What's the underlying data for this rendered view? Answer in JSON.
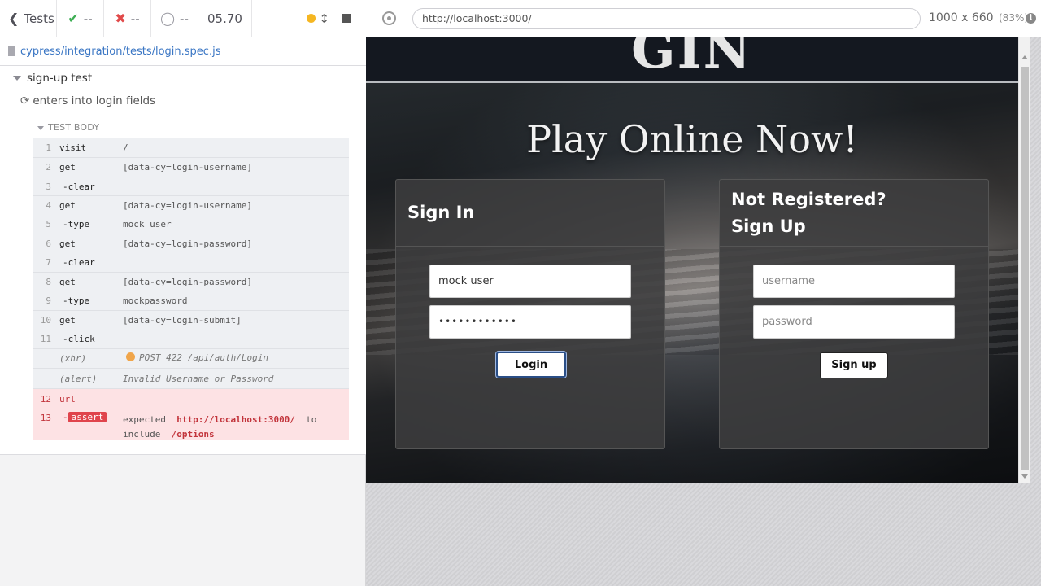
{
  "reporter": {
    "back_label": "Tests",
    "stats": {
      "passed": "--",
      "failed": "--",
      "pending": "--",
      "duration": "05.70"
    },
    "spec_path": "cypress/integration/tests/login.spec.js",
    "suite_title": "sign-up test",
    "test_title": "enters into login fields",
    "body_title": "TEST BODY",
    "commands": [
      {
        "num": "1",
        "name": "visit",
        "msg": "/"
      },
      {
        "num": "2",
        "name": "get",
        "msg": "[data-cy=login-username]"
      },
      {
        "num": "3",
        "name": "-clear",
        "msg": ""
      },
      {
        "num": "4",
        "name": "get",
        "msg": "[data-cy=login-username]"
      },
      {
        "num": "5",
        "name": "-type",
        "msg": "mock user"
      },
      {
        "num": "6",
        "name": "get",
        "msg": "[data-cy=login-password]"
      },
      {
        "num": "7",
        "name": "-clear",
        "msg": ""
      },
      {
        "num": "8",
        "name": "get",
        "msg": "[data-cy=login-password]"
      },
      {
        "num": "9",
        "name": "-type",
        "msg": "mockpassword"
      },
      {
        "num": "10",
        "name": "get",
        "msg": "[data-cy=login-submit]"
      },
      {
        "num": "11",
        "name": "-click",
        "msg": ""
      },
      {
        "num": "",
        "name": "(xhr)",
        "msg": "POST 422 /api/auth/Login"
      },
      {
        "num": "",
        "name": "(alert)",
        "msg": "Invalid Username or Password"
      },
      {
        "num": "12",
        "name": "url",
        "msg": ""
      },
      {
        "num": "13",
        "name": "assert",
        "msg_expected": "expected",
        "msg_url": "http://localhost:3000/",
        "msg_to": "to",
        "msg_include": "include",
        "msg_path": "/options"
      }
    ]
  },
  "preview": {
    "url": "http://localhost:3000/",
    "viewport": "1000 x 660",
    "scale": "(83%)",
    "app": {
      "logo": "GIN",
      "hero": "Play Online Now!",
      "signin": {
        "title": "Sign In",
        "username_value": "mock user",
        "password_mask": "••••••••••••",
        "button": "Login"
      },
      "signup": {
        "title_line1": "Not Registered?",
        "title_line2": "Sign Up",
        "username_placeholder": "username",
        "password_placeholder": "password",
        "button": "Sign up"
      }
    }
  },
  "colors": {
    "pass": "#3dae54",
    "fail": "#e14a4a",
    "link": "#3a76c4",
    "assert_bg": "#e0444c",
    "running": "#f5b621"
  }
}
